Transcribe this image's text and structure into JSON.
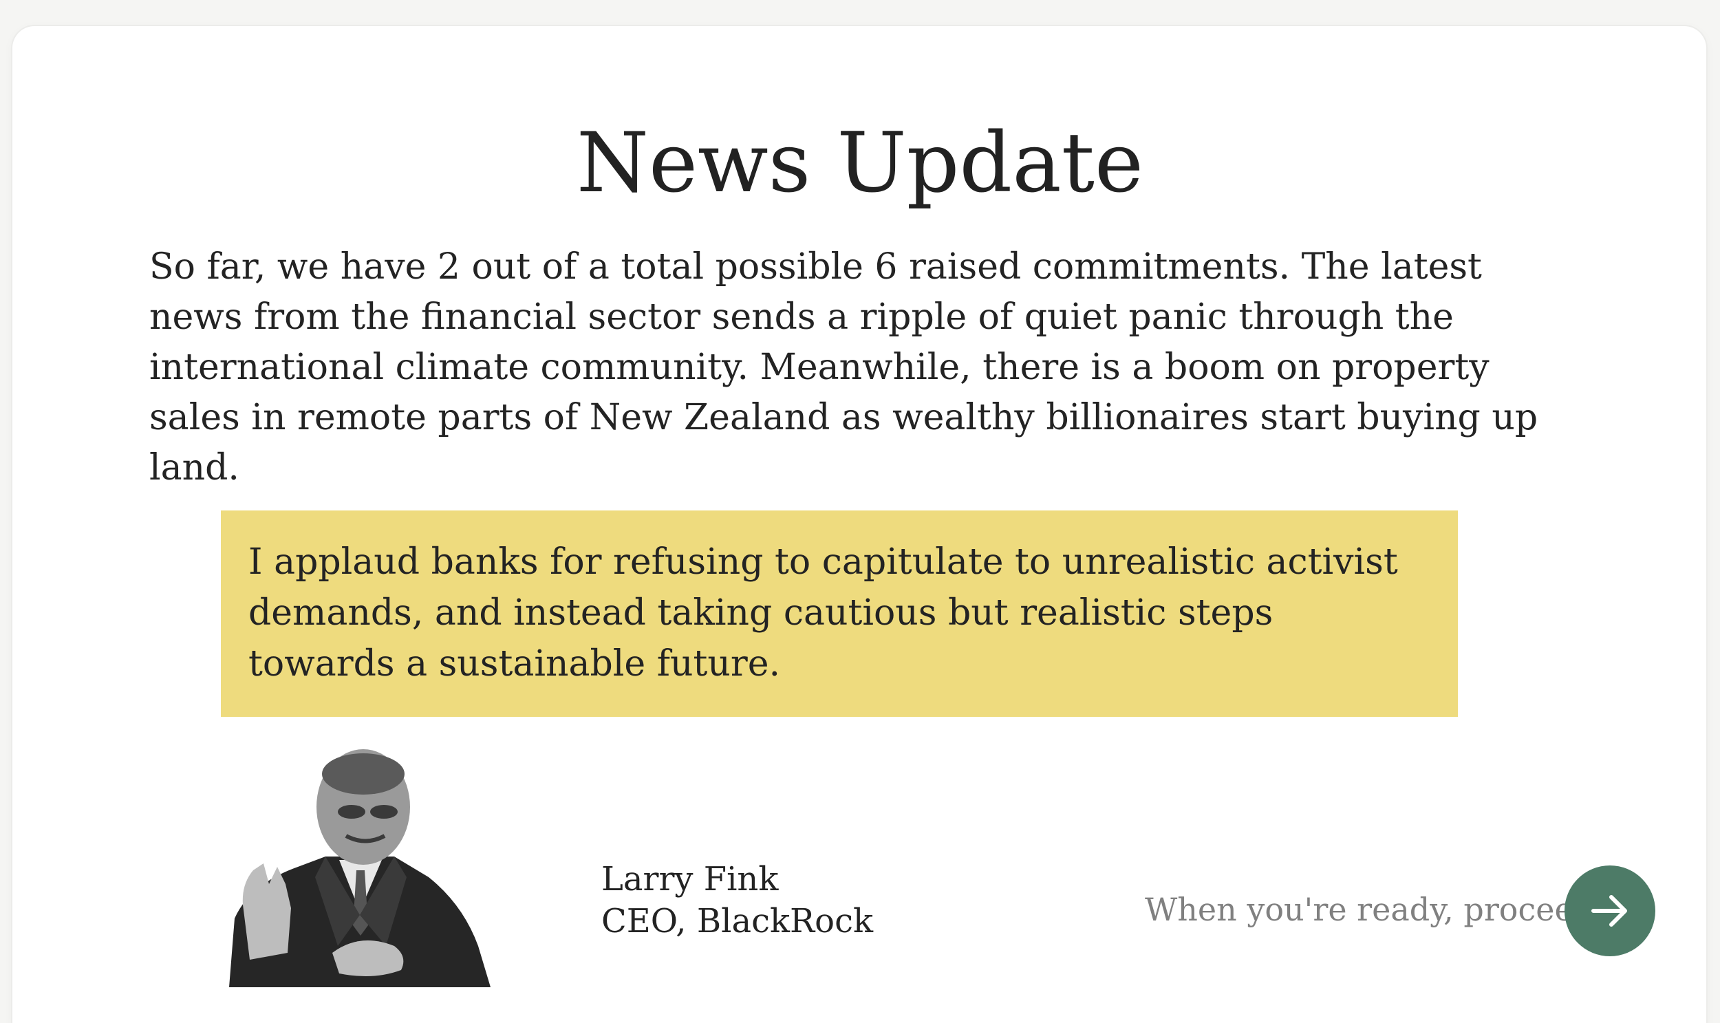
{
  "title": "News Update",
  "intro": "So far, we have 2 out of a total possible 6 raised commitments. The latest news from the financial sector sends a ripple of quiet panic through the international climate community. Meanwhile, there is a boom on property sales in remote parts of New Zealand as wealthy billionaires start buying up land.",
  "quote": {
    "text": "I applaud banks for refusing to capitulate to unrealistic activist demands, and instead taking cautious but realistic steps towards a sustainable future.",
    "background_color": "#eedb7e"
  },
  "speaker": {
    "name": "Larry Fink",
    "role": "CEO, BlackRock",
    "portrait_icon": "person-portrait"
  },
  "proceed": {
    "prompt": "When you're ready, proceed.",
    "button_icon": "arrow-right-icon",
    "button_color": "#4d7b67"
  }
}
